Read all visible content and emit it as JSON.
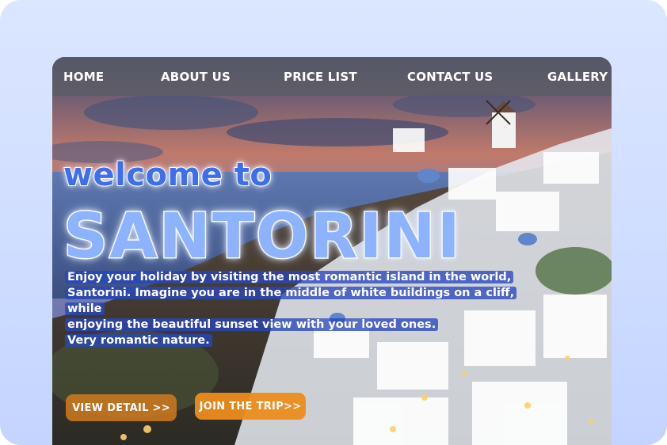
{
  "nav": {
    "items": [
      {
        "label": "HOME"
      },
      {
        "label": "ABOUT US"
      },
      {
        "label": "PRICE LIST"
      },
      {
        "label": "CONTACT US"
      },
      {
        "label": "GALLERY"
      }
    ]
  },
  "hero": {
    "welcome": "welcome to",
    "title": "SANTORINI",
    "description": {
      "line1": "Enjoy your holiday by visiting the most romantic island in the world,",
      "line2": "Santorini. Imagine you are in the middle of white buildings on a cliff, while",
      "line3": "enjoying the beautiful sunset view with your loved ones.",
      "line4": "Very romantic nature."
    },
    "buttons": {
      "detail": "VIEW DETAIL >>",
      "join": "JOIN THE TRIP>>"
    }
  },
  "colors": {
    "background": "#cfddff",
    "accent_blue": "#3e6eea",
    "button_orange": "#e08a20"
  }
}
